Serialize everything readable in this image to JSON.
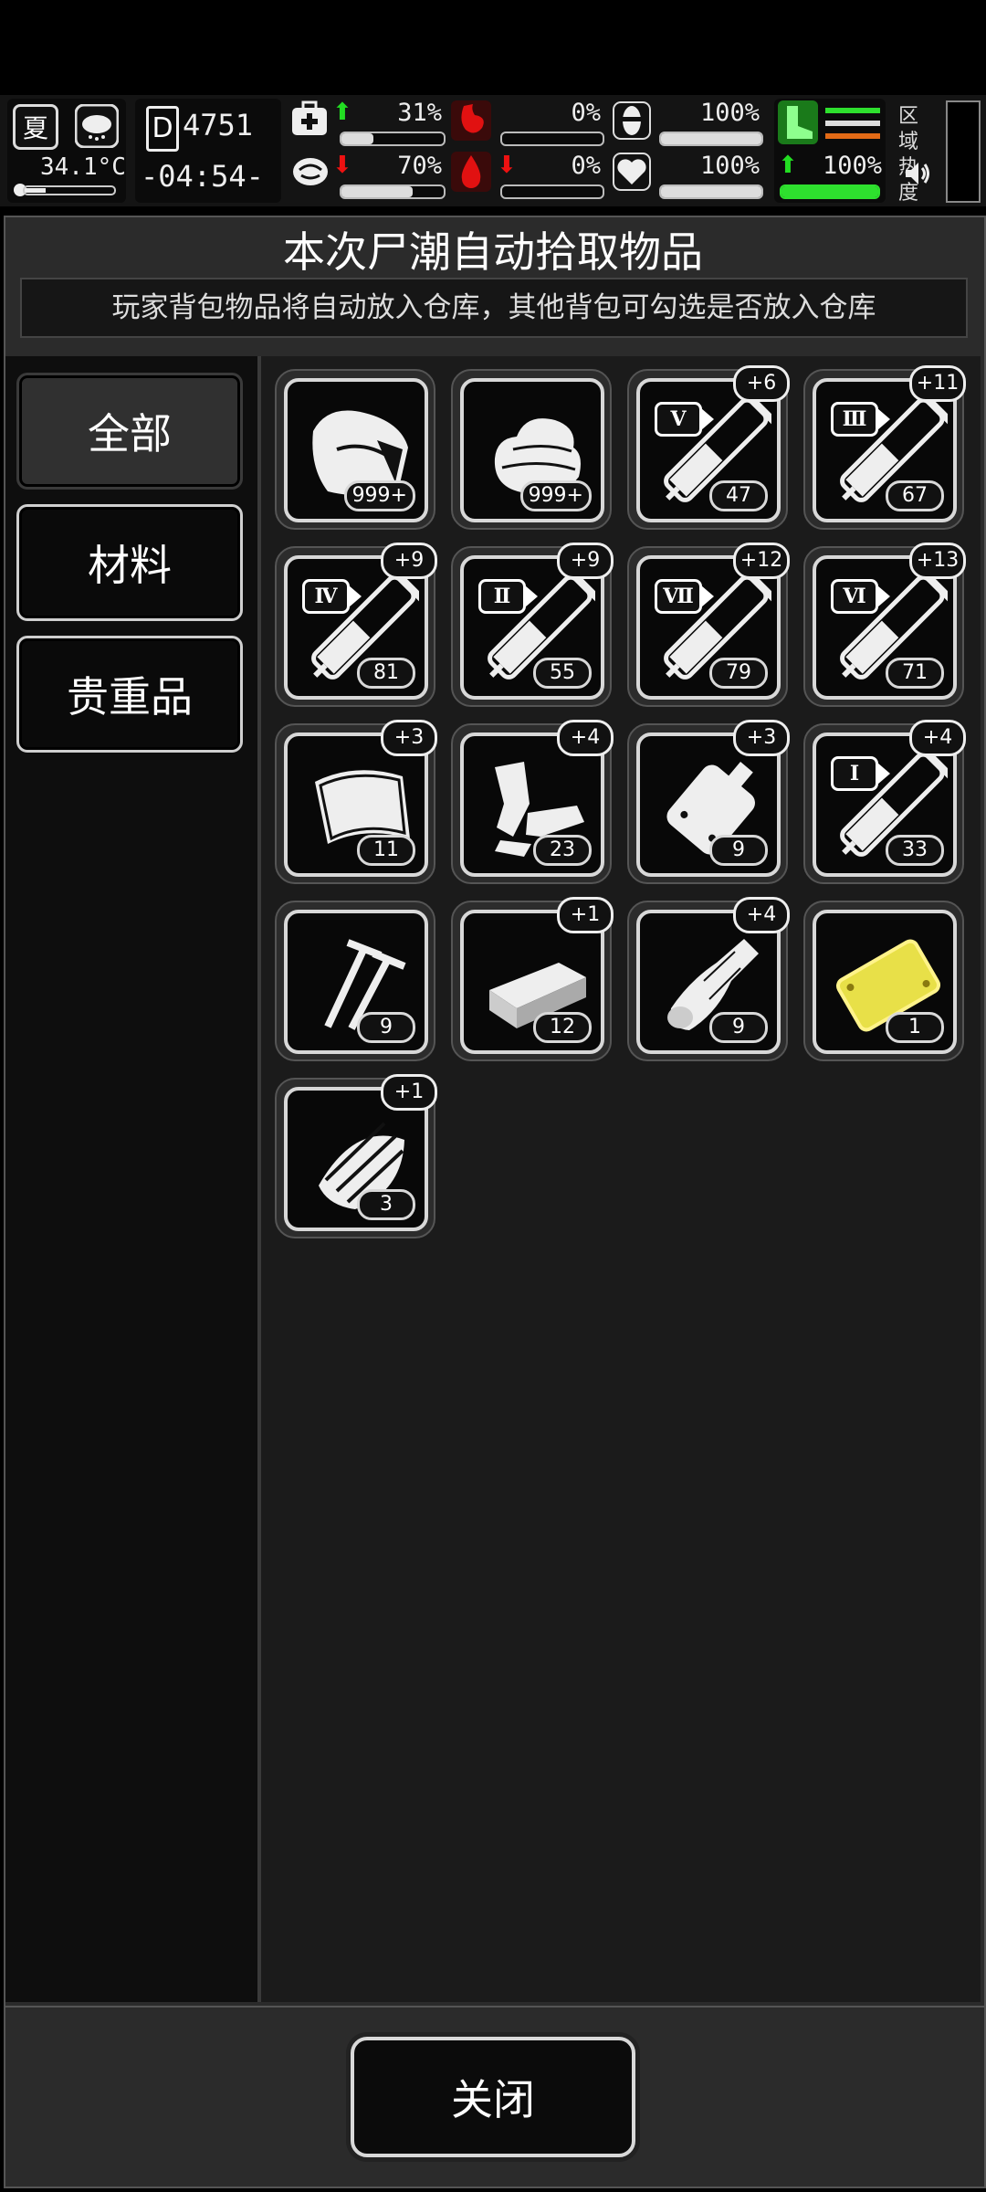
{
  "status_bar": {
    "season": "夏",
    "temperature": "34.1°C",
    "day_label": "D",
    "day_number": "4751",
    "time": "-04:54-",
    "health_pct": "31%",
    "stomach_pct": "0%",
    "armor_pct": "100%",
    "brain_pct": "70%",
    "blood_pct": "0%",
    "heart_pct": "100%",
    "stamina_pct": "100%",
    "zone_heat_label": "区域热度",
    "levels": {
      "health": 0.31,
      "brain": 0.7,
      "armor": 1.0,
      "heart": 1.0,
      "stamina": 1.0
    }
  },
  "dialog": {
    "title": "本次尸潮自动拾取物品",
    "notice": "玩家背包物品将自动放入仓库，其他背包可勾选是否放入仓库"
  },
  "tabs": [
    {
      "label": "全部",
      "active": true
    },
    {
      "label": "材料",
      "active": false
    },
    {
      "label": "贵重品",
      "active": false
    }
  ],
  "items": [
    {
      "icon": "food-pack-icon",
      "count": "999+",
      "bonus": ""
    },
    {
      "icon": "cloth-icon",
      "count": "999+",
      "bonus": ""
    },
    {
      "icon": "syringe-v-icon",
      "roman": "V",
      "count": "47",
      "bonus": "+6"
    },
    {
      "icon": "syringe-iii-icon",
      "roman": "Ⅲ",
      "count": "67",
      "bonus": "+11"
    },
    {
      "icon": "syringe-iv-icon",
      "roman": "Ⅳ",
      "count": "81",
      "bonus": "+9"
    },
    {
      "icon": "syringe-ii-icon",
      "roman": "Ⅱ",
      "count": "55",
      "bonus": "+9"
    },
    {
      "icon": "syringe-vii-icon",
      "roman": "Ⅶ",
      "count": "79",
      "bonus": "+12"
    },
    {
      "icon": "syringe-vi-icon",
      "roman": "Ⅵ",
      "count": "71",
      "bonus": "+13"
    },
    {
      "icon": "bandage-icon",
      "count": "11",
      "bonus": "+3"
    },
    {
      "icon": "scrap-parts-icon",
      "count": "23",
      "bonus": "+4"
    },
    {
      "icon": "blood-bag-icon",
      "count": "9",
      "bonus": "+3"
    },
    {
      "icon": "syringe-i-icon",
      "roman": "I",
      "count": "33",
      "bonus": "+4"
    },
    {
      "icon": "screws-icon",
      "count": "9",
      "bonus": ""
    },
    {
      "icon": "wood-block-icon",
      "count": "12",
      "bonus": "+1"
    },
    {
      "icon": "log-icon",
      "count": "9",
      "bonus": "+4"
    },
    {
      "icon": "gold-plate-icon",
      "count": "1",
      "bonus": ""
    },
    {
      "icon": "wood-chips-icon",
      "count": "3",
      "bonus": "+1"
    }
  ],
  "footer": {
    "close_label": "关闭"
  },
  "colors": {
    "accent_green": "#22dd22",
    "danger_red": "#e11111",
    "gold": "#e8e048"
  }
}
